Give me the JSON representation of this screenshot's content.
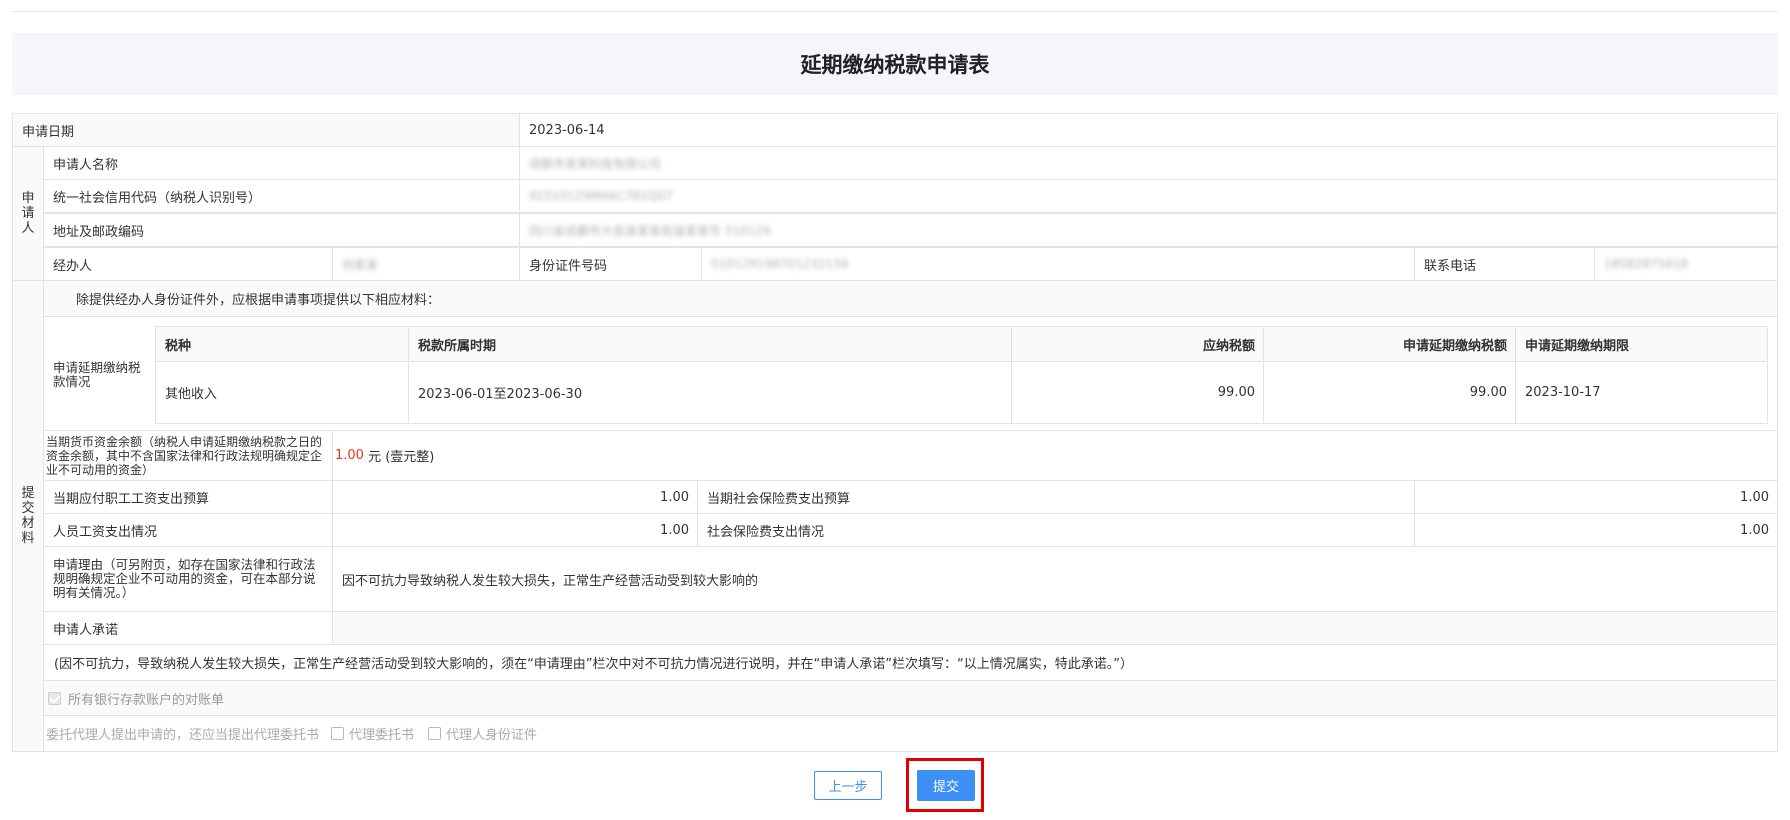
{
  "page": {
    "title": "延期缴纳税款申请表"
  },
  "form": {
    "apply_date_label": "申请日期",
    "apply_date_value": "2023-06-14",
    "applicant_group_label": "申请人",
    "applicant_name_label": "申请人名称",
    "applicant_name_value": "成都市某某科技有限公司",
    "credit_code_label": "统一社会信用代码（纳税人识别号）",
    "credit_code_value": "91510129MA6C7B1Q07",
    "address_label": "地址及邮政编码",
    "address_value": "四川省成都市大邑县某某街道某某号 510129",
    "handler_label": "经办人",
    "handler_value": "刘某某",
    "id_label": "身份证件号码",
    "id_value": "510129198701232134",
    "phone_label": "联系电话",
    "phone_value": "18582875918"
  },
  "materials": {
    "group_label": "提交材料",
    "intro": "除提供经办人身份证件外，应根据申请事项提供以下相应材料：",
    "deferral_label": "申请延期缴纳税款情况",
    "table": {
      "headers": [
        "税种",
        "税款所属时期",
        "应纳税额",
        "申请延期缴纳税额",
        "申请延期缴纳期限"
      ],
      "rows": [
        {
          "tax_type": "其他收入",
          "period": "2023-06-01至2023-06-30",
          "tax_due": "99.00",
          "deferral_amount": "99.00",
          "deadline": "2023-10-17"
        }
      ]
    },
    "fund_balance_label": "当期货币资金余额（纳税人申请延期缴纳税款之日的资金余额，其中不含国家法律和行政法规明确规定企业不可动用的资金）",
    "fund_balance_value": "1.00",
    "fund_balance_unit": "元 (壹元整)",
    "wage_budget_label": "当期应付职工工资支出预算",
    "wage_budget_value": "1.00",
    "social_budget_label": "当期社会保险费支出预算",
    "social_budget_value": "1.00",
    "wage_actual_label": "人员工资支出情况",
    "wage_actual_value": "1.00",
    "social_actual_label": "社会保险费支出情况",
    "social_actual_value": "1.00",
    "reason_label": "申请理由（可另附页，如存在国家法律和行政法规明确规定企业不可动用的资金，可在本部分说明有关情况。）",
    "reason_value": "因不可抗力导致纳税人发生较大损失，正常生产经营活动受到较大影响的",
    "promise_label": "申请人承诺",
    "promise_value": "",
    "note": "(因不可抗力，导致纳税人发生较大损失，正常生产经营活动受到较大影响的，须在“申请理由”栏次中对不可抗力情况进行说明，并在“申请人承诺”栏次填写：“以上情况属实，特此承诺。”）",
    "bank_statement_label": "所有银行存款账户的对账单",
    "agent_intro": "委托代理人提出申请的，还应当提出代理委托书",
    "agent_letter_label": "代理委托书",
    "agent_id_label": "代理人身份证件"
  },
  "buttons": {
    "prev": "上一步",
    "submit": "提交"
  }
}
